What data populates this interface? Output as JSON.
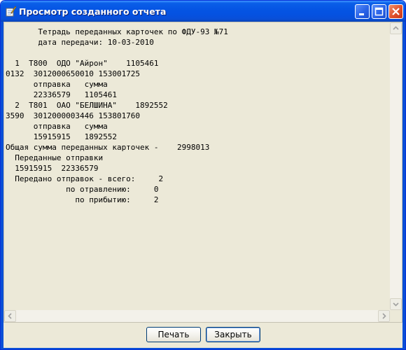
{
  "window": {
    "title": "Просмотр созданного отчета"
  },
  "report": {
    "lines": [
      "       Тетрадь переданных карточек по ФДУ-93 №71",
      "       дата передачи: 10-03-2010",
      "",
      "  1  Т800  ОДО \"Айрон\"    1105461",
      "0132  3012000650010 153001725",
      "      отправка   сумма",
      "      22336579   1105461",
      "  2  Т801  ОАО \"БЕЛШИНА\"    1892552",
      "3590  3012000003446 153801760",
      "      отправка   сумма",
      "      15915915   1892552",
      "Общая сумма переданных карточек -    2998013",
      "  Переданные отправки",
      "  15915915  22336579",
      "  Передано отправок - всего:     2",
      "             по отравлению:     0",
      "               по прибытию:     2"
    ]
  },
  "buttons": {
    "print_label": "Печать",
    "close_label": "Закрыть"
  },
  "icons": {
    "app": "notepad-pen-icon",
    "minimize": "minimize-icon",
    "maximize": "maximize-icon",
    "close": "close-icon",
    "scroll_up": "arrow-up-icon",
    "scroll_down": "arrow-down-icon",
    "scroll_left": "arrow-left-icon",
    "scroll_right": "arrow-right-icon"
  }
}
